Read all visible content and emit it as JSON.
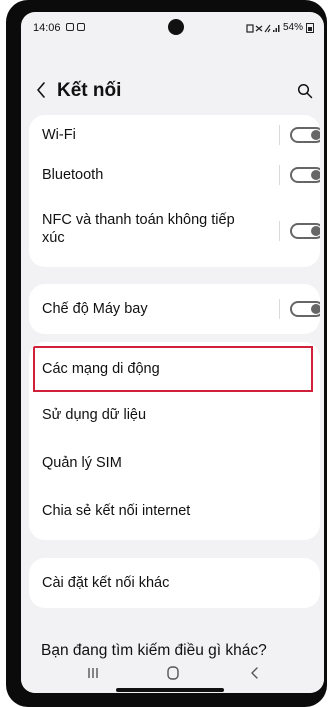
{
  "status_bar": {
    "time": "14:06",
    "right_text": "54%"
  },
  "header": {
    "title": "Kết nối"
  },
  "settings": {
    "wifi": {
      "label": "Wi-Fi",
      "enabled": false
    },
    "bluetooth": {
      "label": "Bluetooth",
      "enabled": false
    },
    "nfc": {
      "label_line1": "NFC và thanh toán không tiếp",
      "label_line2": "xúc",
      "enabled": false
    },
    "airplane": {
      "label": "Chế độ Máy bay",
      "enabled": false
    },
    "mobile_networks": {
      "label": "Các mạng di động"
    },
    "data_usage": {
      "label": "Sử dụng dữ liệu"
    },
    "sim_manager": {
      "label": "Quản lý SIM"
    },
    "hotspot": {
      "label": "Chia sẻ kết nối internet"
    },
    "more_settings": {
      "label": "Cài đặt kết nối khác"
    }
  },
  "footer": {
    "prompt": "Bạn đang tìm kiếm điều gì khác?"
  },
  "colors": {
    "background": "#f2f2f4",
    "card": "#ffffff",
    "highlight": "#d0203a"
  },
  "icons": {
    "back": "back-arrow-icon",
    "search": "search-icon",
    "recents": "recents-icon",
    "home": "home-icon",
    "nav_back": "nav-back-icon"
  }
}
